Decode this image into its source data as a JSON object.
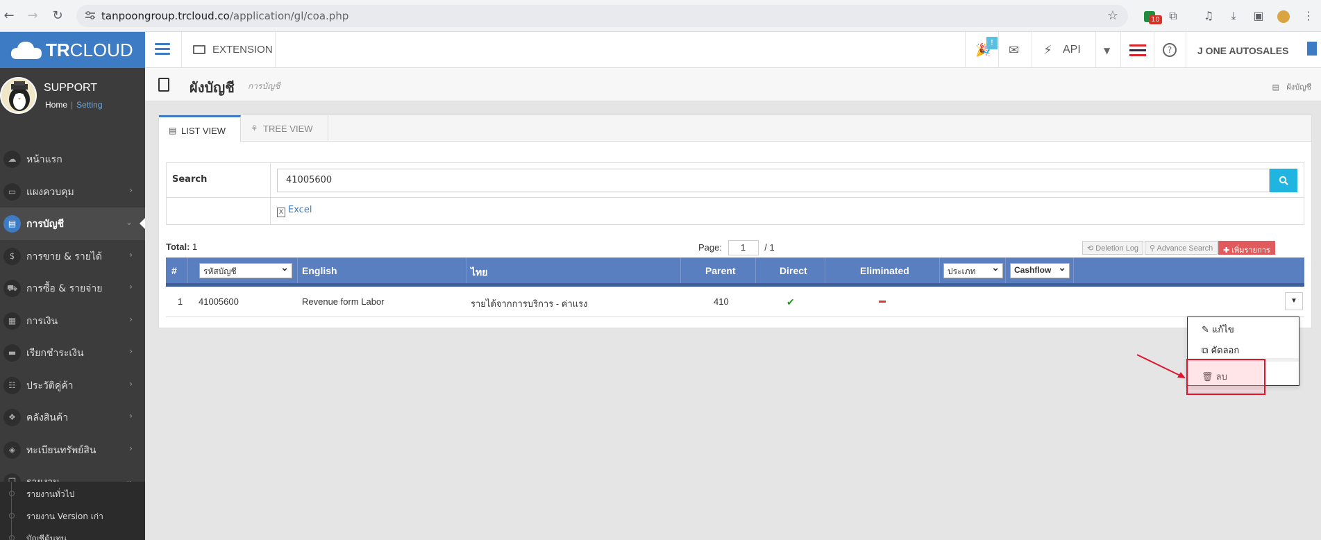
{
  "browser": {
    "url_host": "tanpoongroup.trcloud.co",
    "url_path": "/application/gl/coa.php",
    "ext_badge": "10"
  },
  "sidebar": {
    "logo_bold": "TR",
    "logo_rest": "CLOUD",
    "profile_name": "SUPPORT",
    "home_link": "Home",
    "setting_link": "Setting",
    "items": [
      {
        "label": "หน้าแรก",
        "icon": "cloud-icon",
        "glyph": "☁",
        "chevron": false
      },
      {
        "label": "แผงควบคุม",
        "icon": "monitor-icon",
        "glyph": "▭",
        "chevron": true
      },
      {
        "label": "การบัญชี",
        "icon": "book-icon",
        "glyph": "▤",
        "chevron": true,
        "active": true
      },
      {
        "label": "การขาย & รายได้",
        "icon": "dollar-icon",
        "glyph": "$",
        "chevron": true
      },
      {
        "label": "การซื้อ & รายจ่าย",
        "icon": "cart-icon",
        "glyph": "⛟",
        "chevron": true
      },
      {
        "label": "การเงิน",
        "icon": "calendar-icon",
        "glyph": "▦",
        "chevron": true
      },
      {
        "label": "เรียกชำระเงิน",
        "icon": "card-icon",
        "glyph": "▬",
        "chevron": true
      },
      {
        "label": "ประวัติคู่ค้า",
        "icon": "contact-icon",
        "glyph": "☷",
        "chevron": true
      },
      {
        "label": "คลังสินค้า",
        "icon": "cubes-icon",
        "glyph": "❖",
        "chevron": true
      },
      {
        "label": "ทะเบียนทรัพย์สิน",
        "icon": "diamond-icon",
        "glyph": "◈",
        "chevron": true
      },
      {
        "label": "รายงาน",
        "icon": "copy-icon",
        "glyph": "❐",
        "chevron": true
      }
    ],
    "sub_items": [
      "รายงานทั่วไป",
      "รายงาน Version เก่า",
      "บัญชีต้นทุน"
    ]
  },
  "topbar": {
    "extension_label": "EXTENSION",
    "notif_count": "!",
    "api_label": "API",
    "user_label": "J ONE AUTOSALES"
  },
  "page": {
    "title": "ผังบัญชี",
    "subtitle": "การบัญชี",
    "crumb": "ผังบัญชี"
  },
  "tabs": [
    {
      "label": "LIST VIEW",
      "active": true
    },
    {
      "label": "TREE VIEW",
      "active": false
    }
  ],
  "search": {
    "label": "Search",
    "value": "41005600",
    "excel_label": "Excel"
  },
  "list": {
    "total_label": "Total:",
    "total_value": "1",
    "page_label": "Page:",
    "page_value": "1",
    "page_total": "/ 1",
    "deletion_log": "Deletion Log",
    "advance_search": "Advance Search",
    "add_label": "เพิ่มรายการ"
  },
  "table": {
    "headers": {
      "num": "#",
      "code": "รหัสบัญชี",
      "english": "English",
      "thai": "ไทย",
      "parent": "Parent",
      "direct": "Direct",
      "eliminated": "Eliminated",
      "type": "ประเภท",
      "cashflow": "Cashflow"
    },
    "rows": [
      {
        "num": "1",
        "code": "41005600",
        "english": "Revenue form Labor",
        "thai": "รายได้จากการบริการ - ค่าแรง",
        "parent": "410",
        "direct": true,
        "eliminated": false
      }
    ]
  },
  "dropdown": {
    "edit": "แก้ไข",
    "copy": "คัดลอก",
    "delete": "ลบ"
  },
  "colors": {
    "brand": "#3d7bc4",
    "table_header": "#5a7fc1",
    "search_button": "#1fb5e0",
    "add_button": "#e05b5b",
    "highlight": "#e0142f"
  }
}
